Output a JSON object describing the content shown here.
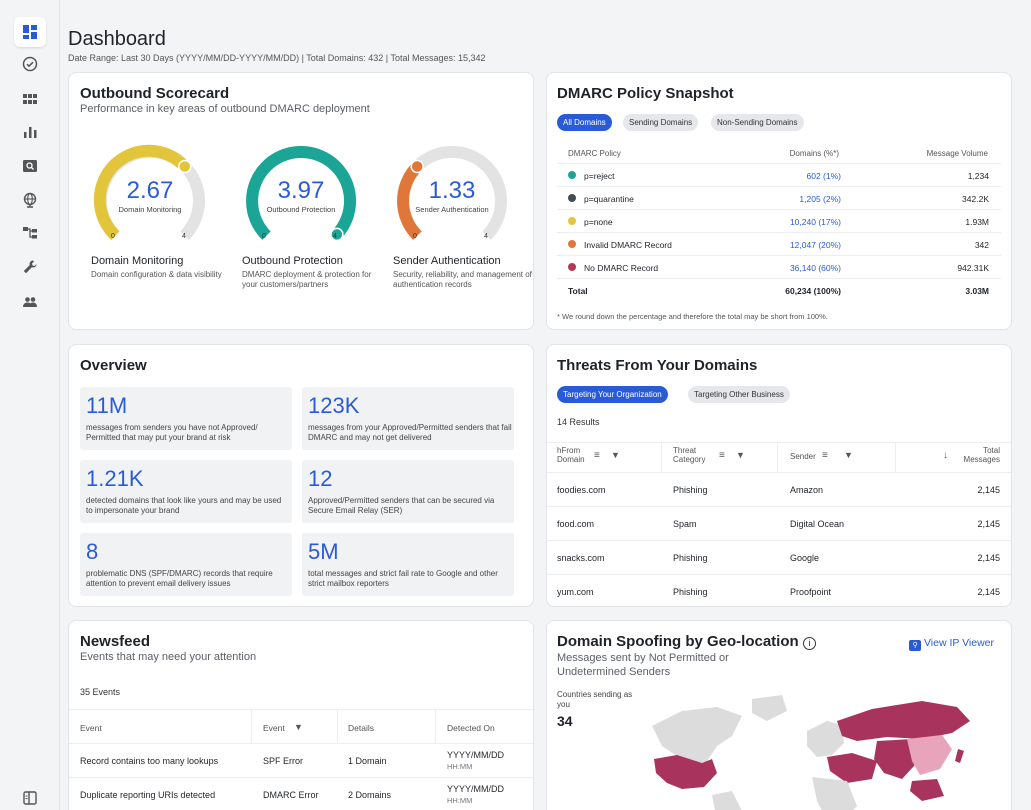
{
  "header": {
    "title": "Dashboard",
    "subtitle": "Date Range: Last 30 Days (YYYY/MM/DD-YYYY/MM/DD) | Total Domains: 432 | Total Messages: 15,342"
  },
  "sidebar": {
    "items": [
      {
        "icon": "dashboard-icon",
        "active": true
      },
      {
        "icon": "check-circle-icon"
      },
      {
        "icon": "grid-icon"
      },
      {
        "icon": "bar-chart-icon"
      },
      {
        "icon": "search-box-icon"
      },
      {
        "icon": "globe-icon"
      },
      {
        "icon": "network-icon"
      },
      {
        "icon": "wrench-icon"
      },
      {
        "icon": "users-icon"
      }
    ],
    "bottom_icon": "collapse-panel-icon"
  },
  "scorecard": {
    "title": "Outbound Scorecard",
    "subtitle": "Performance in key areas of outbound DMARC deployment",
    "gauges": [
      {
        "value": "2.67",
        "label": "Domain Monitoring",
        "min": "0",
        "max": "4",
        "color": "#e2c53b",
        "fraction": 0.6675,
        "name": "Domain Monitoring",
        "desc": "Domain configuration & data visibility"
      },
      {
        "value": "3.97",
        "label": "Outbound Protection",
        "min": "0",
        "max": "4",
        "color": "#1aa596",
        "fraction": 0.9925,
        "name": "Outbound Protection",
        "desc": "DMARC deployment & protection for your customers/partners"
      },
      {
        "value": "1.33",
        "label": "Sender Authentication",
        "min": "0",
        "max": "4",
        "color": "#e0773a",
        "fraction": 0.3325,
        "name": "Sender Authentication",
        "desc": "Security, reliability, and management of authentication records"
      }
    ]
  },
  "dmarc": {
    "title": "DMARC Policy Snapshot",
    "tabs": [
      "All Domains",
      "Sending Domains",
      "Non-Sending Domains"
    ],
    "columns": [
      "DMARC Policy",
      "Domains (%*)",
      "Message Volume"
    ],
    "rows": [
      {
        "policy": "p=reject",
        "domains": "602 (1%)",
        "volume": "1,234",
        "color": "#1aa596"
      },
      {
        "policy": "p=quarantine",
        "domains": "1,205 (2%)",
        "volume": "342.2K",
        "color": "#444b55"
      },
      {
        "policy": "p=none",
        "domains": "10,240 (17%)",
        "volume": "1.93M",
        "color": "#e2c53b"
      },
      {
        "policy": "Invalid DMARC Record",
        "domains": "12,047 (20%)",
        "volume": "342",
        "color": "#e0773a"
      },
      {
        "policy": "No DMARC Record",
        "domains": "36,140 (60%)",
        "volume": "942.31K",
        "color": "#b23a55"
      }
    ],
    "total": {
      "label": "Total",
      "domains": "60,234 (100%)",
      "volume": "3.03M"
    },
    "footnote": "* We round down the percentage and therefore the total may be short from 100%."
  },
  "overview": {
    "title": "Overview",
    "items": [
      {
        "value": "11M",
        "desc": "messages from senders you have not Approved/ Permitted that may put your brand at risk"
      },
      {
        "value": "123K",
        "desc": "messages from your Approved/Permitted senders that fail DMARC and may not get delivered"
      },
      {
        "value": "1.21K",
        "desc": "detected domains that look like yours and may be used to impersonate your brand"
      },
      {
        "value": "12",
        "desc": "Approved/Permitted senders that can be secured via Secure Email Relay (SER)"
      },
      {
        "value": "8",
        "desc": "problematic DNS (SPF/DMARC) records that require attention to prevent email delivery issues"
      },
      {
        "value": "5M",
        "desc": "total messages and strict fail rate to Google and other strict mailbox reporters"
      }
    ]
  },
  "threats": {
    "title": "Threats From Your Domains",
    "tabs": [
      "Targeting Your Organization",
      "Targeting Other Business"
    ],
    "results": "14 Results",
    "columns": [
      "hFrom\nDomain",
      "Threat\nCategory",
      "Sender",
      "Total\nMessages"
    ],
    "col1a": "hFrom",
    "col1b": "Domain",
    "col2a": "Threat",
    "col2b": "Category",
    "col3": "Sender",
    "col4a": "Total",
    "col4b": "Messages",
    "rows": [
      {
        "domain": "foodies.com",
        "category": "Phishing",
        "sender": "Amazon",
        "total": "2,145"
      },
      {
        "domain": "food.com",
        "category": "Spam",
        "sender": "Digital Ocean",
        "total": "2,145"
      },
      {
        "domain": "snacks.com",
        "category": "Phishing",
        "sender": "Google",
        "total": "2,145"
      },
      {
        "domain": "yum.com",
        "category": "Phishing",
        "sender": "Proofpoint",
        "total": "2,145"
      }
    ]
  },
  "newsfeed": {
    "title": "Newsfeed",
    "subtitle": "Events that may need your attention",
    "count": "35 Events",
    "columns": [
      "Event",
      "Event",
      "Details",
      "Detected On"
    ],
    "rows": [
      {
        "event": "Record contains too many lookups",
        "type": "SPF Error",
        "details": "1 Domain",
        "date": "YYYY/MM/DD",
        "time": "HH:MM"
      },
      {
        "event": "Duplicate reporting URIs detected",
        "type": "DMARC Error",
        "details": "2 Domains",
        "date": "YYYY/MM/DD",
        "time": "HH:MM"
      }
    ]
  },
  "geo": {
    "title": "Domain Spoofing by Geo-location",
    "subtitle": "Messages sent by Not Permitted or Undetermined Senders",
    "link": "View IP Viewer",
    "stat_label": "Countries sending as you",
    "stat_value": "34",
    "colors": {
      "high": "#a8345e",
      "low": "#e8a4bb",
      "none": "#dcdcdc"
    }
  }
}
